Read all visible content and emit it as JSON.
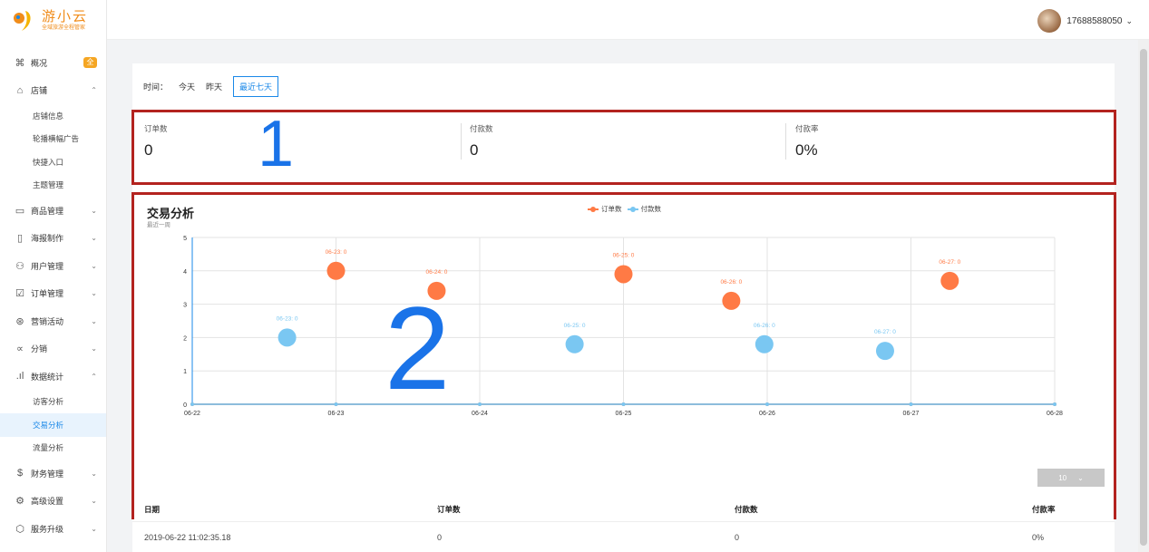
{
  "brand": {
    "name": "游小云",
    "slogan": "全域旅游全程管家",
    "colors": {
      "orange": "#f08c1a",
      "blue": "#1a88e8"
    }
  },
  "user": {
    "phone": "17688588050"
  },
  "sidebar": {
    "items": [
      {
        "label": "概况",
        "icon": "command-icon",
        "badge": "全"
      },
      {
        "label": "店铺",
        "icon": "home-icon",
        "expanded": true,
        "children": [
          "店铺信息",
          "轮播横幅广告",
          "快捷入口",
          "主题管理"
        ]
      },
      {
        "label": "商品管理",
        "icon": "calendar-icon"
      },
      {
        "label": "海报制作",
        "icon": "map-icon"
      },
      {
        "label": "用户管理",
        "icon": "users-icon"
      },
      {
        "label": "订单管理",
        "icon": "checkbox-icon"
      },
      {
        "label": "营销活动",
        "icon": "globe-icon"
      },
      {
        "label": "分销",
        "icon": "share-icon"
      },
      {
        "label": "数据统计",
        "icon": "bar-chart-icon",
        "expanded": true,
        "children": [
          "访客分析",
          "交易分析",
          "流量分析"
        ],
        "active_child": "交易分析"
      },
      {
        "label": "财务管理",
        "icon": "dollar-icon"
      },
      {
        "label": "高级设置",
        "icon": "gear-icon"
      },
      {
        "label": "服务升级",
        "icon": "cube-icon"
      }
    ]
  },
  "time_filter": {
    "label": "时间：",
    "options": [
      "今天",
      "昨天"
    ],
    "active": "最近七天"
  },
  "stats": [
    {
      "label": "订单数",
      "value": "0"
    },
    {
      "label": "付款数",
      "value": "0"
    },
    {
      "label": "付款率",
      "value": "0%"
    }
  ],
  "annotations": {
    "one": "1",
    "two": "2"
  },
  "chart_card": {
    "title": "交易分析",
    "subtitle": "最近一周"
  },
  "chart_data": {
    "type": "line",
    "categories": [
      "06-22",
      "06-23",
      "06-24",
      "06-25",
      "06-26",
      "06-27",
      "06-28"
    ],
    "ylim": [
      0,
      5
    ],
    "yticks": [
      0,
      1,
      2,
      3,
      4,
      5
    ],
    "grid": true,
    "legend": "top-center",
    "series": [
      {
        "name": "订单数",
        "color": "#ff7a45",
        "values": [
          0,
          0,
          0,
          0,
          0,
          0,
          0
        ]
      },
      {
        "name": "付款数",
        "color": "#7ac7f2",
        "values": [
          0,
          0,
          0,
          0,
          0,
          0,
          0
        ]
      }
    ],
    "tooltips": [
      {
        "text": "06-23: 0",
        "series": "订单数",
        "x": 1.0,
        "y": 4.0
      },
      {
        "text": "06-24: 0",
        "series": "订单数",
        "x": 1.7,
        "y": 3.4
      },
      {
        "text": "06-25: 0",
        "series": "订单数",
        "x": 3.0,
        "y": 3.9
      },
      {
        "text": "06-26: 0",
        "series": "订单数",
        "x": 3.75,
        "y": 3.1
      },
      {
        "text": "06-27: 0",
        "series": "订单数",
        "x": 5.27,
        "y": 3.7
      },
      {
        "text": "06-23: 0",
        "series": "付款数",
        "x": 0.66,
        "y": 2.0
      },
      {
        "text": "06-25: 0",
        "series": "付款数",
        "x": 2.66,
        "y": 1.8
      },
      {
        "text": "06-26: 0",
        "series": "付款数",
        "x": 3.98,
        "y": 1.8
      },
      {
        "text": "06-27: 0",
        "series": "付款数",
        "x": 4.82,
        "y": 1.6
      }
    ]
  },
  "table": {
    "page_size": "10",
    "headers": [
      "日期",
      "订单数",
      "付款数",
      "付款率"
    ],
    "rows": [
      [
        "2019-06-22 11:02:35.18",
        "0",
        "0",
        "0%"
      ]
    ]
  }
}
